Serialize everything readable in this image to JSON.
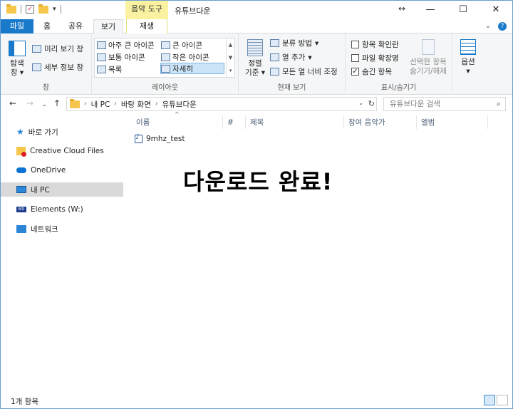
{
  "titlebar": {
    "context_tab": "음악 도구",
    "title": "유튜브다운",
    "minimize": "—",
    "maximize": "☐",
    "close": "✕",
    "resize_glyph": "↔"
  },
  "tabs": {
    "file": "파일",
    "home": "홈",
    "share": "공유",
    "view": "보기",
    "play": "재생"
  },
  "ribbon": {
    "panes": {
      "nav_pane_line1": "탐색",
      "nav_pane_line2": "창",
      "preview": "미리 보기 창",
      "details": "세부 정보 창",
      "label": "창"
    },
    "layout": {
      "extra_large": "아주 큰 아이콘",
      "large": "큰 아이콘",
      "medium": "보통 아이콘",
      "small": "작은 아이콘",
      "list": "목록",
      "details": "자세히",
      "label": "레이아웃"
    },
    "current_view": {
      "sort_line1": "정렬",
      "sort_line2": "기준",
      "group_by": "분류 방법",
      "add_columns": "열 추가",
      "size_all": "모든 열 너비 조정",
      "label": "현재 보기"
    },
    "show_hide": {
      "item_checkboxes": "항목 확인란",
      "extensions": "파일 확장명",
      "hidden_items": "숨긴 항목",
      "hide_selected_line1": "선택한 항목",
      "hide_selected_line2": "숨기기/해제",
      "label": "표시/숨기기",
      "checks": {
        "item_checkboxes": false,
        "extensions": false,
        "hidden_items": true
      }
    },
    "options": {
      "label": "옵션"
    }
  },
  "address": {
    "crumbs": [
      "내 PC",
      "바탕 화면",
      "유튜브다운"
    ],
    "search_placeholder": "유튜브다운 검색"
  },
  "nav": {
    "items": [
      {
        "label": "바로 가기",
        "icon": "star-icon"
      },
      {
        "label": "Creative Cloud Files",
        "icon": "creative-cloud-icon"
      },
      {
        "label": "OneDrive",
        "icon": "onedrive-icon"
      },
      {
        "label": "내 PC",
        "icon": "pc-icon"
      },
      {
        "label": "Elements (W:)",
        "icon": "drive-icon"
      },
      {
        "label": "네트워크",
        "icon": "network-icon"
      }
    ]
  },
  "columns": {
    "name": "이름",
    "number": "#",
    "title": "제목",
    "artists": "참여 음악가",
    "album": "앨범"
  },
  "files": [
    {
      "name": "9mhz_test",
      "icon": "music-file-icon"
    }
  ],
  "overlay_text": "다운로드 완료!",
  "status": {
    "count": "1개 항목"
  }
}
